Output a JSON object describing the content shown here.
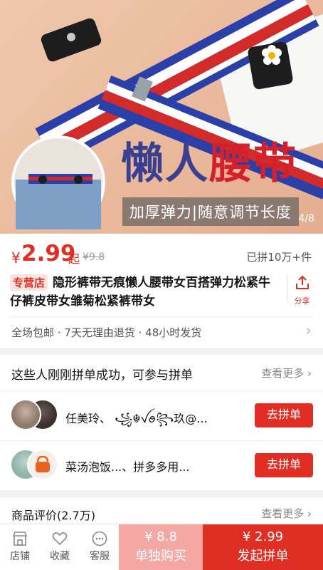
{
  "hero": {
    "title_part1": "懒人",
    "title_part2": "腰带",
    "subtitle": "加厚弹力|随意调节长度",
    "counter": "4/8"
  },
  "price": {
    "currency": "¥",
    "value": "2.99",
    "suffix": "起",
    "original": "¥9.8",
    "sold": "已拼10万+件"
  },
  "product": {
    "store_tag": "专营店",
    "title": "隐形裤带无痕懒人腰带女百搭弹力松紧牛仔裤皮带女雏菊松紧裤带女",
    "share_label": "分享"
  },
  "services": {
    "text": "全场包邮 · 7天无理由退货 · 48小时发货"
  },
  "group_buy": {
    "heading": "这些人刚刚拼单成功，可参与拼单",
    "more": "查看更多",
    "rows": [
      {
        "names": "任美玲、 ꧁☬ꪜꪮ꧂玖@...",
        "button": "去拼单"
      },
      {
        "names": "菜汤泡饭...、拼多多用...",
        "button": "去拼单"
      }
    ]
  },
  "reviews": {
    "title": "商品评价(2.7万)",
    "more": "查看更多"
  },
  "bottom_bar": {
    "store": "店铺",
    "favorite": "收藏",
    "service": "客服",
    "single_price": "¥ 8.8",
    "single_label": "单独购买",
    "group_price": "¥ 2.99",
    "group_label": "发起拼单"
  },
  "colors": {
    "accent": "#e02e24",
    "single_button": "#f5a7a3"
  }
}
